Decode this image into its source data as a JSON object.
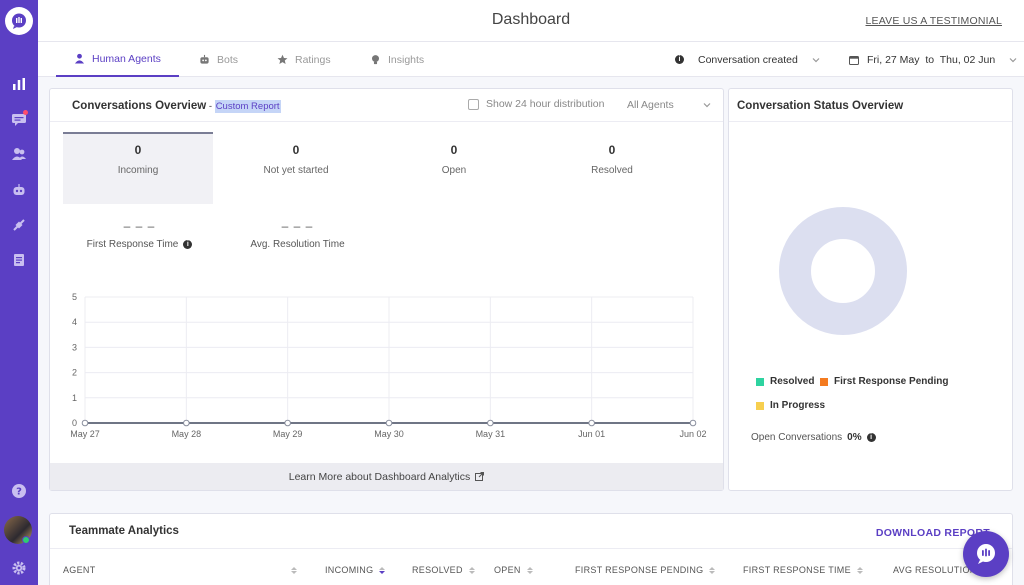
{
  "header": {
    "title": "Dashboard",
    "testimonial_link": "LEAVE US A TESTIMONIAL"
  },
  "tabs": [
    {
      "label": "Human Agents",
      "icon": "person-icon",
      "active": true
    },
    {
      "label": "Bots",
      "icon": "bot-icon",
      "active": false
    },
    {
      "label": "Ratings",
      "icon": "star-icon",
      "active": false
    },
    {
      "label": "Insights",
      "icon": "lightbulb-icon",
      "active": false
    }
  ],
  "filters": {
    "event": "Conversation created",
    "date_range": "Fri, 27 May  to  Thu, 02 Jun"
  },
  "overview": {
    "title": "Conversations Overview",
    "subtitle_prefix": " - ",
    "subtitle_link": "Custom Report",
    "checkbox_label": "Show 24 hour distribution",
    "agent_select": "All Agents",
    "stats": [
      {
        "label": "Incoming",
        "value": "0"
      },
      {
        "label": "Not yet started",
        "value": "0"
      },
      {
        "label": "Open",
        "value": "0"
      },
      {
        "label": "Resolved",
        "value": "0"
      }
    ],
    "metrics": [
      {
        "label": "First Response Time",
        "value": "– – –"
      },
      {
        "label": "Avg. Resolution Time",
        "value": "– – –"
      }
    ],
    "learn_more": "Learn More about Dashboard Analytics"
  },
  "chart_data": {
    "type": "line",
    "categories": [
      "May 27",
      "May 28",
      "May 29",
      "May 30",
      "May 31",
      "Jun 01",
      "Jun 02"
    ],
    "series": [
      {
        "values": [
          0,
          0,
          0,
          0,
          0,
          0,
          0
        ]
      }
    ],
    "yticks": [
      "0",
      "1",
      "2",
      "3",
      "4",
      "5"
    ],
    "ylim": [
      0,
      5
    ],
    "grid": true
  },
  "status_overview": {
    "title": "Conversation Status Overview",
    "legend": [
      {
        "label": "Resolved",
        "color": "#2ed3a0"
      },
      {
        "label": "First Response Pending",
        "color": "#f47b20"
      },
      {
        "label": "In Progress",
        "color": "#f7cf4f"
      }
    ],
    "open_label": "Open Conversations",
    "open_value": "0%",
    "donut_color": "#dcdff0"
  },
  "teammate": {
    "title": "Teammate Analytics",
    "download": "DOWNLOAD REPORT",
    "columns": [
      "AGENT",
      "INCOMING",
      "RESOLVED",
      "OPEN",
      "FIRST RESPONSE PENDING",
      "FIRST RESPONSE TIME",
      "AVG RESOLUTION"
    ]
  },
  "colors": {
    "brand": "#5b3fc4"
  }
}
